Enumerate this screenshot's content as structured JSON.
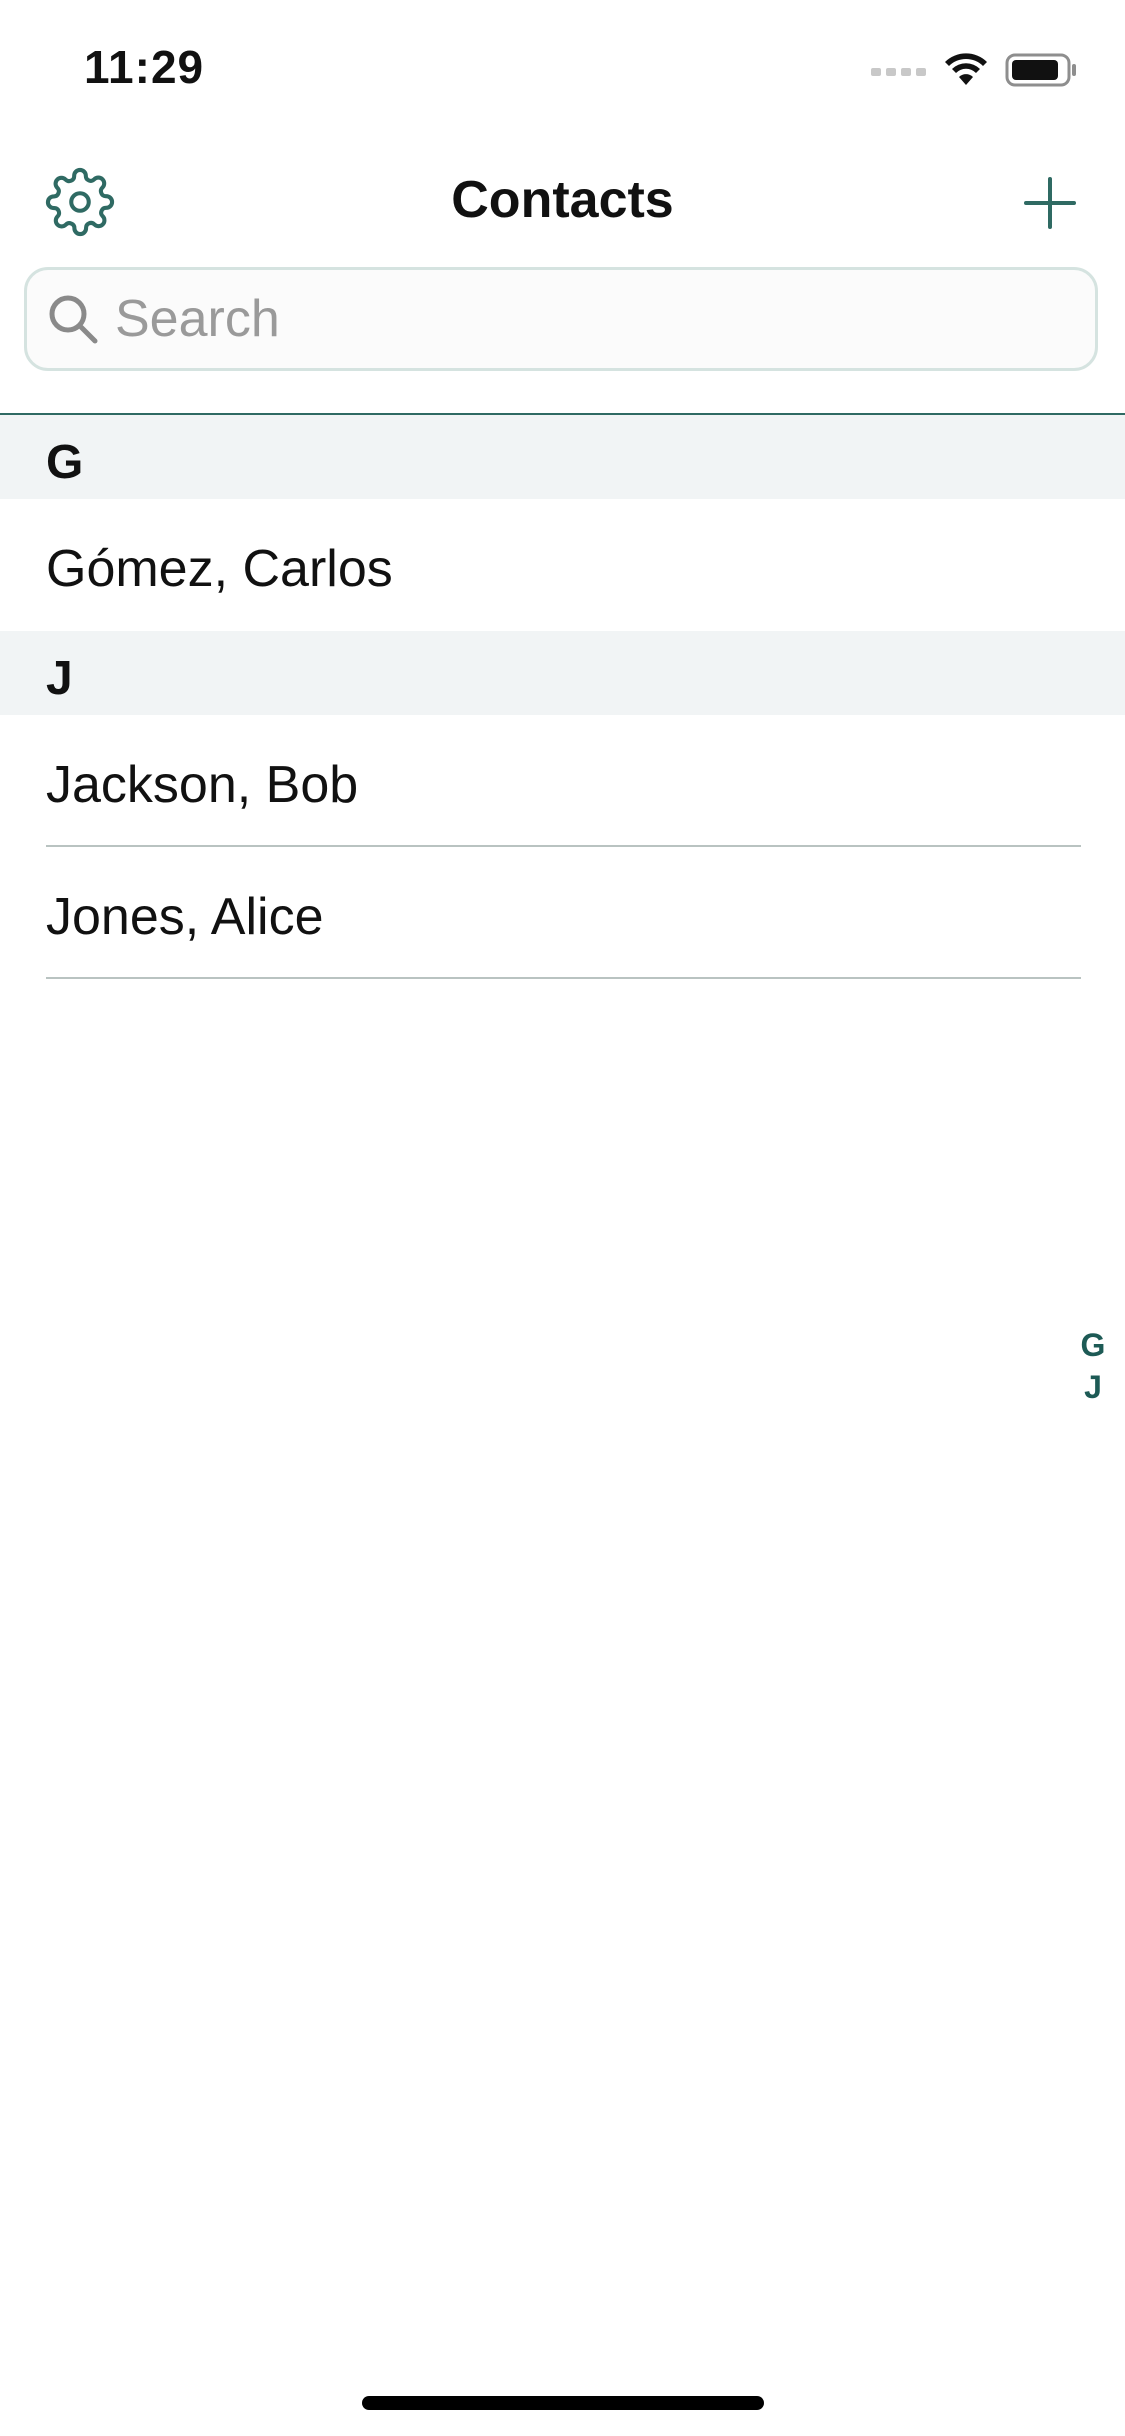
{
  "status_bar": {
    "time": "11:29"
  },
  "nav": {
    "title": "Contacts",
    "settings_icon": "gear-icon",
    "add_icon": "plus-icon"
  },
  "search": {
    "placeholder": "Search",
    "value": ""
  },
  "sections": [
    {
      "letter": "G",
      "contacts": [
        "Gómez, Carlos"
      ]
    },
    {
      "letter": "J",
      "contacts": [
        "Jackson, Bob",
        "Jones, Alice"
      ]
    }
  ],
  "index": [
    "G",
    "J"
  ],
  "colors": {
    "accent": "#2f6a63",
    "section_background": "#f1f4f5"
  }
}
